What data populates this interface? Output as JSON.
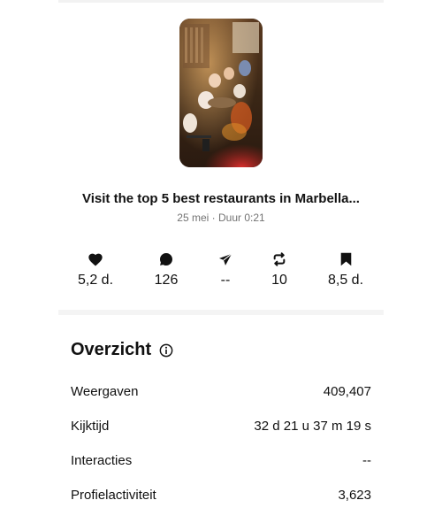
{
  "reel": {
    "title": "Visit the top 5 best restaurants in Marbella...",
    "meta": "25 mei · Duur 0:21"
  },
  "stats": [
    {
      "icon": "heart-icon",
      "value": "5,2 d."
    },
    {
      "icon": "comment-icon",
      "value": "126"
    },
    {
      "icon": "share-icon",
      "value": "--"
    },
    {
      "icon": "repost-icon",
      "value": "10"
    },
    {
      "icon": "bookmark-icon",
      "value": "8,5 d."
    }
  ],
  "overview": {
    "title": "Overzicht",
    "rows": [
      {
        "label": "Weergaven",
        "value": "409,407"
      },
      {
        "label": "Kijktijd",
        "value": "32 d 21 u 37 m 19 s"
      },
      {
        "label": "Interacties",
        "value": "--"
      },
      {
        "label": "Profielactiviteit",
        "value": "3,623"
      }
    ]
  },
  "colors": {
    "text": "#111111",
    "muted": "#737373",
    "divider": "#f4f4f4"
  }
}
